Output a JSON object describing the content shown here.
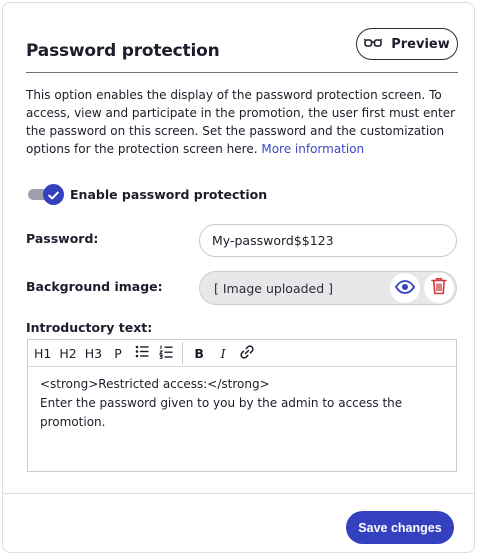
{
  "header": {
    "title": "Password protection",
    "preview_label": "Preview"
  },
  "description": {
    "text": "This option enables the display of the password protection screen. To access, view and participate in the promotion, the user first must enter the password on this screen. Set the password and the customization options for the protection screen here.",
    "link_text": "More information"
  },
  "toggle": {
    "label": "Enable password protection",
    "checked": true
  },
  "password": {
    "label": "Password:",
    "value": "My-password$$123"
  },
  "background_image": {
    "label": "Background image:",
    "value": "[ Image uploaded ]"
  },
  "intro": {
    "label": "Introductory text:",
    "toolbar": [
      "H1",
      "H2",
      "H3",
      "P",
      "B",
      "I"
    ],
    "content": "<strong>Restricted access:</strong>\nEnter the password given to you by the admin to access the promotion."
  },
  "footer": {
    "save_label": "Save changes"
  },
  "colors": {
    "accent": "#3341c1",
    "link": "#3b49c7",
    "delete": "#d23a3a"
  },
  "icons": [
    "glasses-icon",
    "check-icon",
    "eye-icon",
    "trash-icon",
    "bullet-list-icon",
    "numbered-list-icon",
    "link-icon"
  ]
}
